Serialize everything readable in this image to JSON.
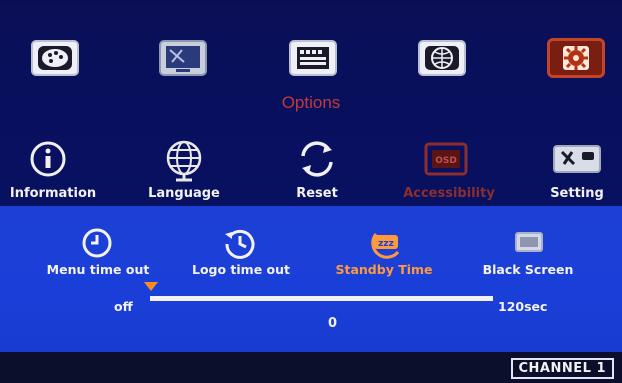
{
  "menu": {
    "title": "Options",
    "top_icons": [
      {
        "name": "palette-icon"
      },
      {
        "name": "display-icon"
      },
      {
        "name": "film-icon"
      },
      {
        "name": "network-icon"
      },
      {
        "name": "gear-icon",
        "selected": true
      }
    ]
  },
  "options": {
    "items": [
      {
        "label": "Information"
      },
      {
        "label": "Language"
      },
      {
        "label": "Reset"
      },
      {
        "label": "Accessibility",
        "dimmed": true
      },
      {
        "label": "Setting"
      }
    ],
    "osd_badge": "OSD"
  },
  "accessibility": {
    "items": [
      {
        "label": "Menu time out"
      },
      {
        "label": "Logo time out"
      },
      {
        "label": "Standby Time",
        "active": true
      },
      {
        "label": "Black Screen"
      }
    ],
    "standby_badge": "zzz",
    "slider": {
      "min_label": "off",
      "max_label": "120sec",
      "value": "0"
    }
  },
  "status": {
    "channel": "CHANNEL 1"
  },
  "colors": {
    "accent": "#ff9a3c",
    "selected_bg": "#7a1e12",
    "dim_text": "#8a2e2e",
    "title": "#c03a3a"
  }
}
